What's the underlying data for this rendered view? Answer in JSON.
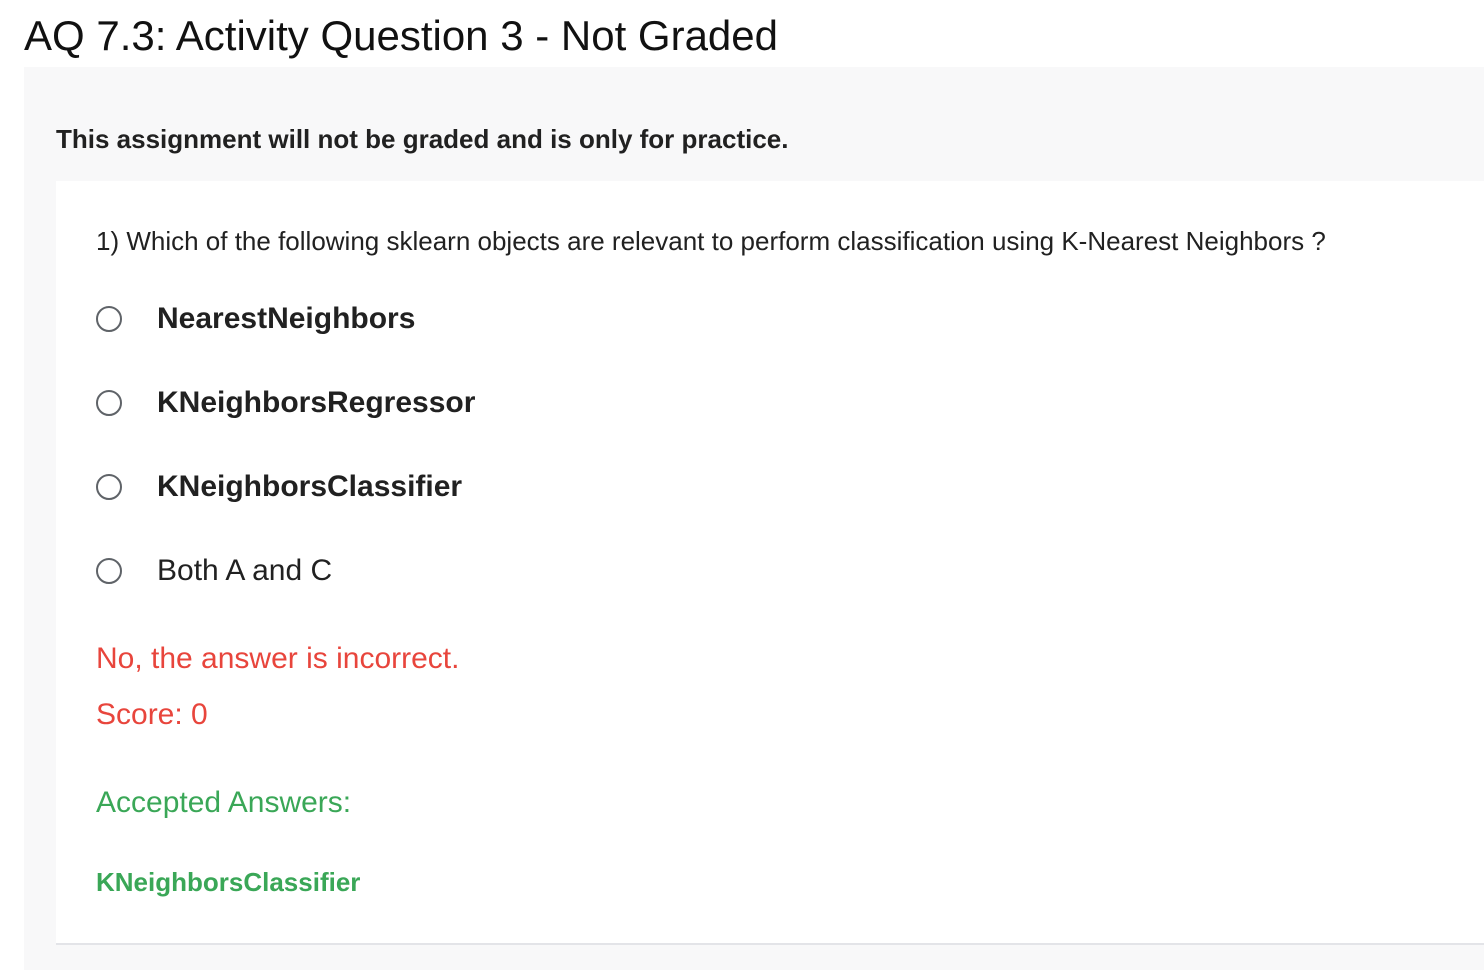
{
  "page": {
    "title": "AQ 7.3: Activity Question 3 - Not Graded"
  },
  "notice": "This assignment will not be graded and is only for practice.",
  "question": {
    "text": "1) Which of the following sklearn objects are relevant to perform classification using K-Nearest Neighbors ?",
    "options": [
      {
        "label": "NearestNeighbors",
        "selected": false
      },
      {
        "label": "KNeighborsRegressor",
        "selected": false
      },
      {
        "label": "KNeighborsClassifier",
        "selected": false
      },
      {
        "label": "Both A and C",
        "selected": false
      }
    ]
  },
  "feedback": {
    "result": "No, the answer is incorrect.",
    "score": "Score: 0",
    "accepted_heading": "Accepted Answers:",
    "accepted_values": [
      "KNeighborsClassifier"
    ]
  },
  "colors": {
    "incorrect": "#e8453c",
    "accepted": "#3aa757",
    "panel_background": "#f8f8f9"
  }
}
